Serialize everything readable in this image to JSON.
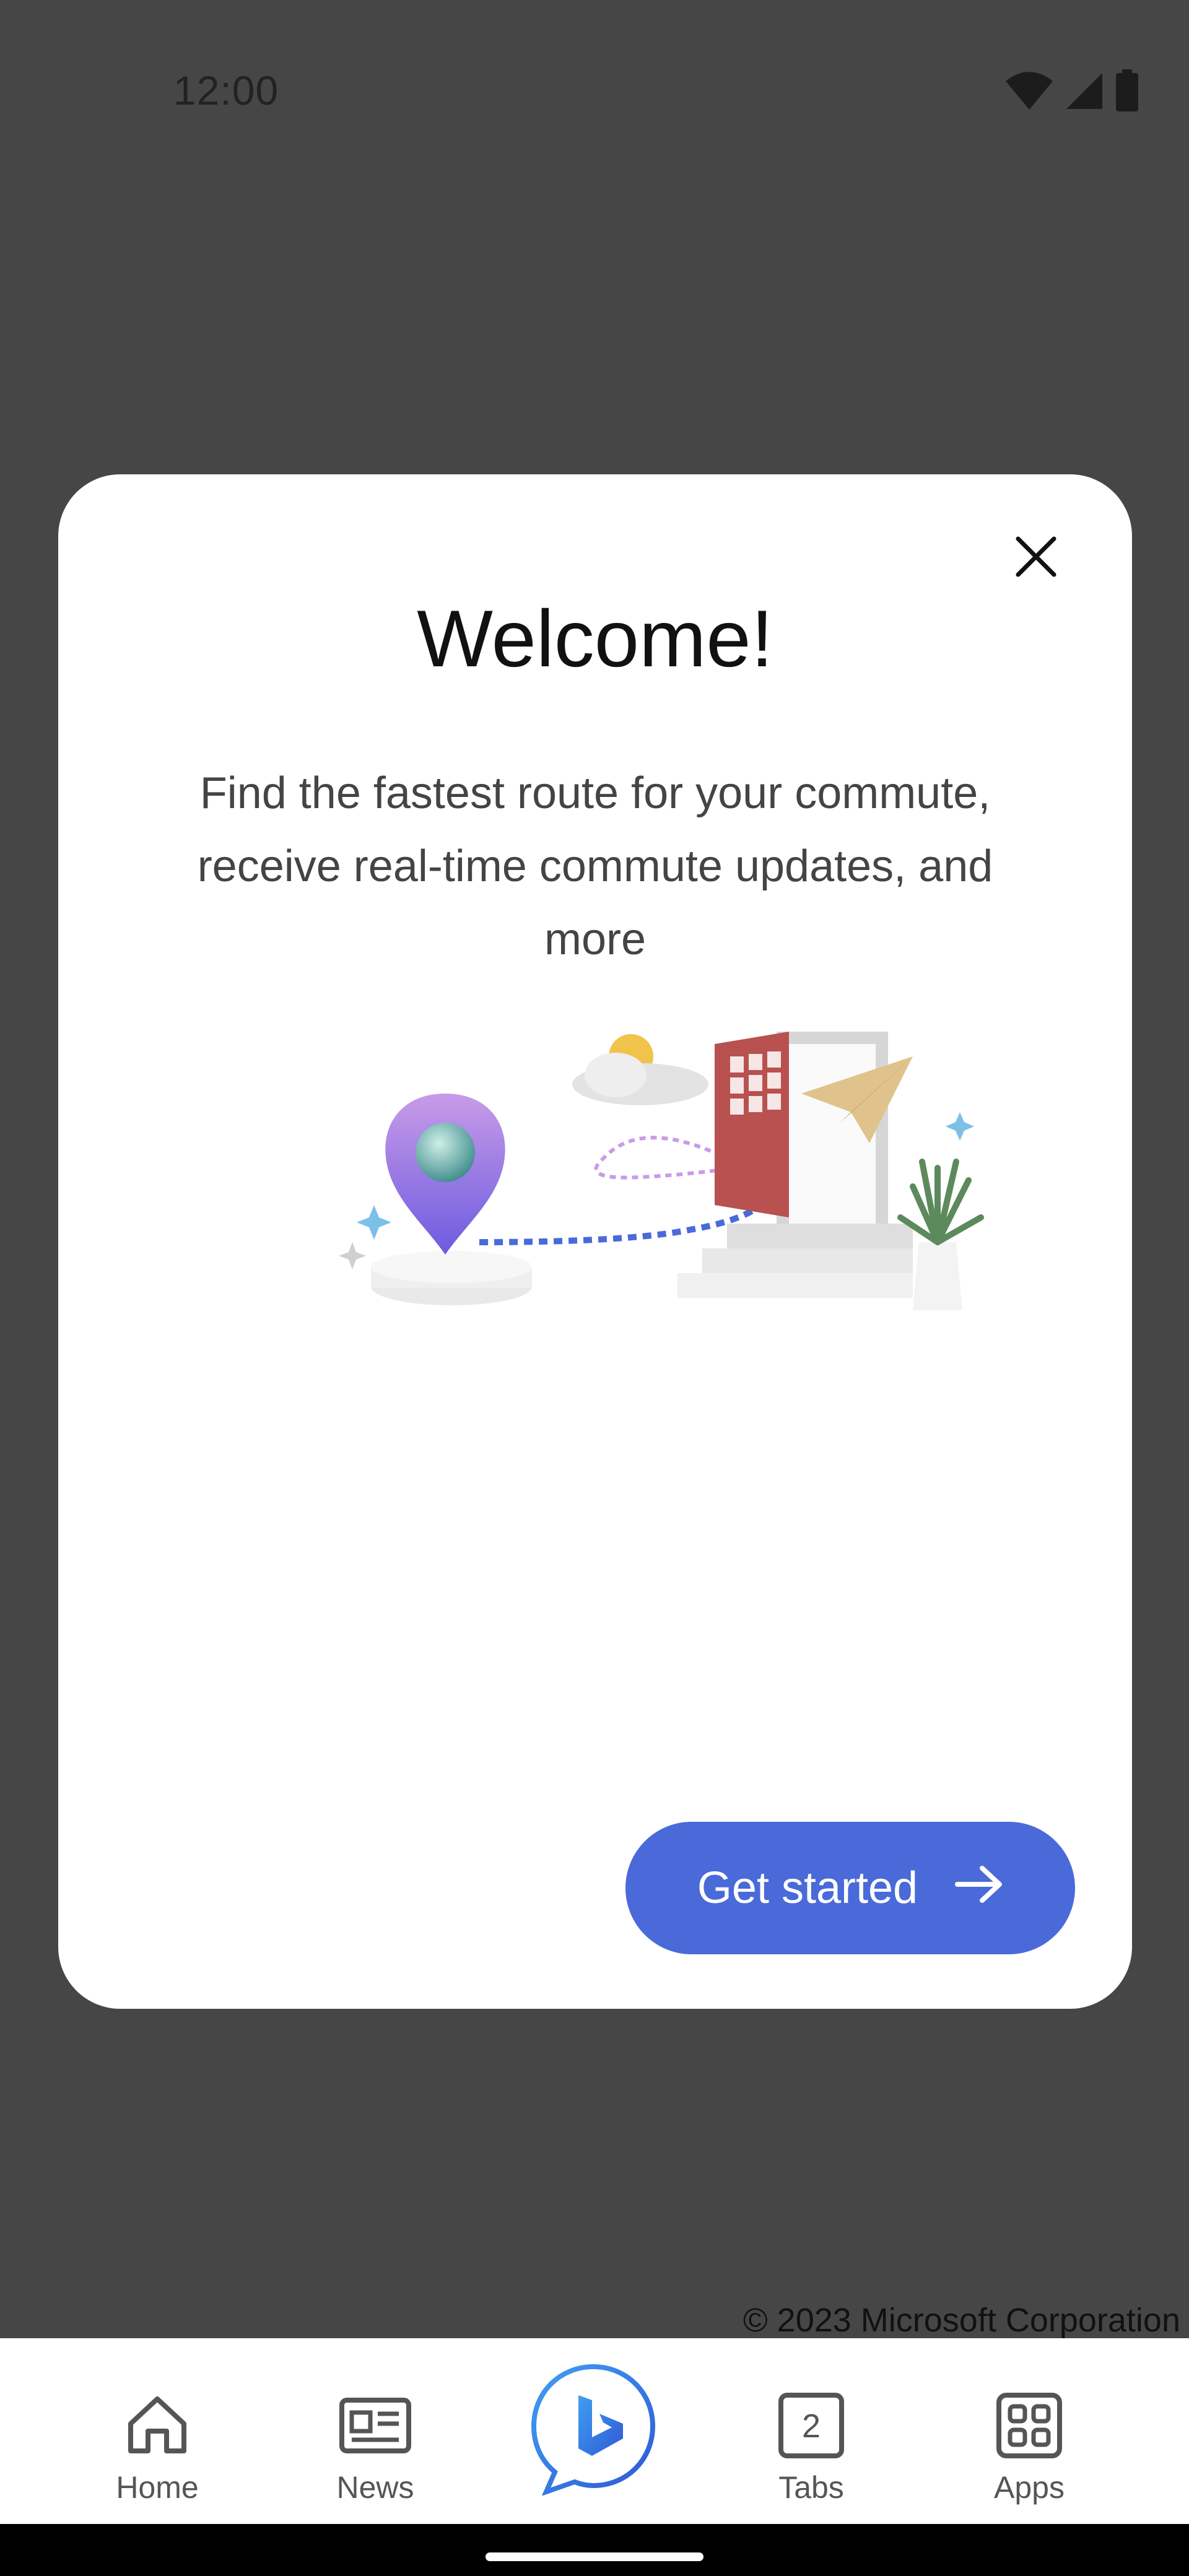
{
  "status_bar": {
    "time": "12:00",
    "icons": [
      "wifi-icon",
      "signal-icon",
      "battery-icon"
    ]
  },
  "modal": {
    "title": "Welcome!",
    "description": "Find the fastest route for your commute, receive real-time commute updates, and more",
    "close_icon": "close-icon",
    "cta_label": "Get started",
    "cta_icon": "arrow-right-icon",
    "cta_color": "#4a6ad9"
  },
  "footer": {
    "copyright": "© 2023 Microsoft Corporation"
  },
  "bottom_nav": {
    "items": [
      {
        "label": "Home",
        "icon": "home-icon"
      },
      {
        "label": "News",
        "icon": "news-icon"
      },
      {
        "label": "",
        "icon": "bing-chat-icon"
      },
      {
        "label": "Tabs",
        "icon": "tabs-icon",
        "count": "2"
      },
      {
        "label": "Apps",
        "icon": "apps-icon"
      }
    ],
    "active_indicator_color": "#4a6ad9"
  },
  "colors": {
    "overlay": "#464646",
    "card": "#ffffff",
    "accent": "#4a6ad9"
  }
}
